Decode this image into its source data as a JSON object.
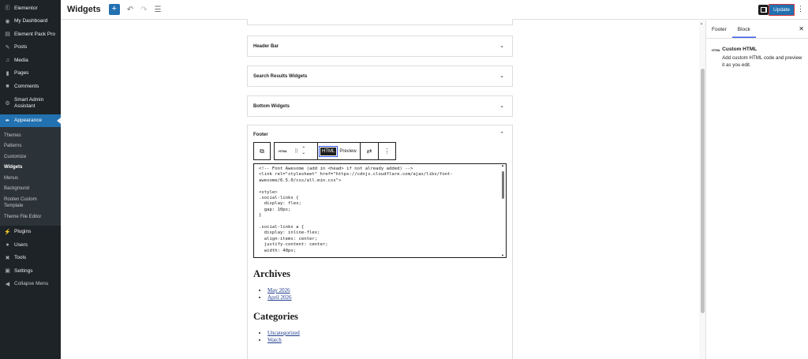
{
  "sidebar": {
    "items": [
      {
        "label": "Elementor",
        "icon": "elementor-icon"
      },
      {
        "label": "My Dashboard",
        "icon": "dashboard-icon"
      },
      {
        "label": "Element Pack Pro",
        "icon": "element-pack-icon"
      },
      {
        "label": "Posts",
        "icon": "pin-icon"
      },
      {
        "label": "Media",
        "icon": "media-icon"
      },
      {
        "label": "Pages",
        "icon": "pages-icon"
      },
      {
        "label": "Comments",
        "icon": "comments-icon"
      },
      {
        "label": "Smart Admin Assistant",
        "icon": "assistant-icon"
      },
      {
        "label": "Appearance",
        "icon": "brush-icon"
      }
    ],
    "submenu": [
      "Themes",
      "Patterns",
      "Customize",
      "Widgets",
      "Menus",
      "Background",
      "Rooten Custom Template",
      "Theme File Editor"
    ],
    "items_after": [
      {
        "label": "Plugins",
        "icon": "plugins-icon"
      },
      {
        "label": "Users",
        "icon": "users-icon"
      },
      {
        "label": "Tools",
        "icon": "tools-icon"
      },
      {
        "label": "Settings",
        "icon": "settings-icon"
      },
      {
        "label": "Collapse Menu",
        "icon": "collapse-icon"
      }
    ]
  },
  "header": {
    "title": "Widgets",
    "update_label": "Update"
  },
  "widget_areas": [
    "Header Bar",
    "Search Results Widgets",
    "Bottom Widgets"
  ],
  "footer": {
    "title": "Footer",
    "toolbar": {
      "block_label": "HTML",
      "html_tab": "HTML",
      "preview_tab": "Preview"
    },
    "code": "<!-- Font Awesome (add in <head> if not already added) -->\n<link rel=\"stylesheet\" href=\"https://cdnjs.cloudflare.com/ajax/libs/font-\nawesome/6.5.0/css/all.min.css\">\n\n<style>\n.social-links {\n  display: flex;\n  gap: 10px;\n}\n\n.social-links a {\n  display: inline-flex;\n  align-items: center;\n  justify-content: center;\n  width: 40px;",
    "archives_heading": "Archives",
    "archives": [
      "May 2026",
      "April 2026"
    ],
    "categories_heading": "Categories",
    "categories": [
      "Uncategorized",
      "Watch"
    ]
  },
  "settings": {
    "tabs": [
      "Footer",
      "Block"
    ],
    "active_tab": "Block",
    "block_icon_label": "HTML",
    "block_name": "Custom HTML",
    "block_description": "Add custom HTML code and preview it as you edit."
  },
  "colors": {
    "admin_bar": "#1d2327",
    "accent": "#2271b1",
    "active_outline": "#d63638"
  }
}
